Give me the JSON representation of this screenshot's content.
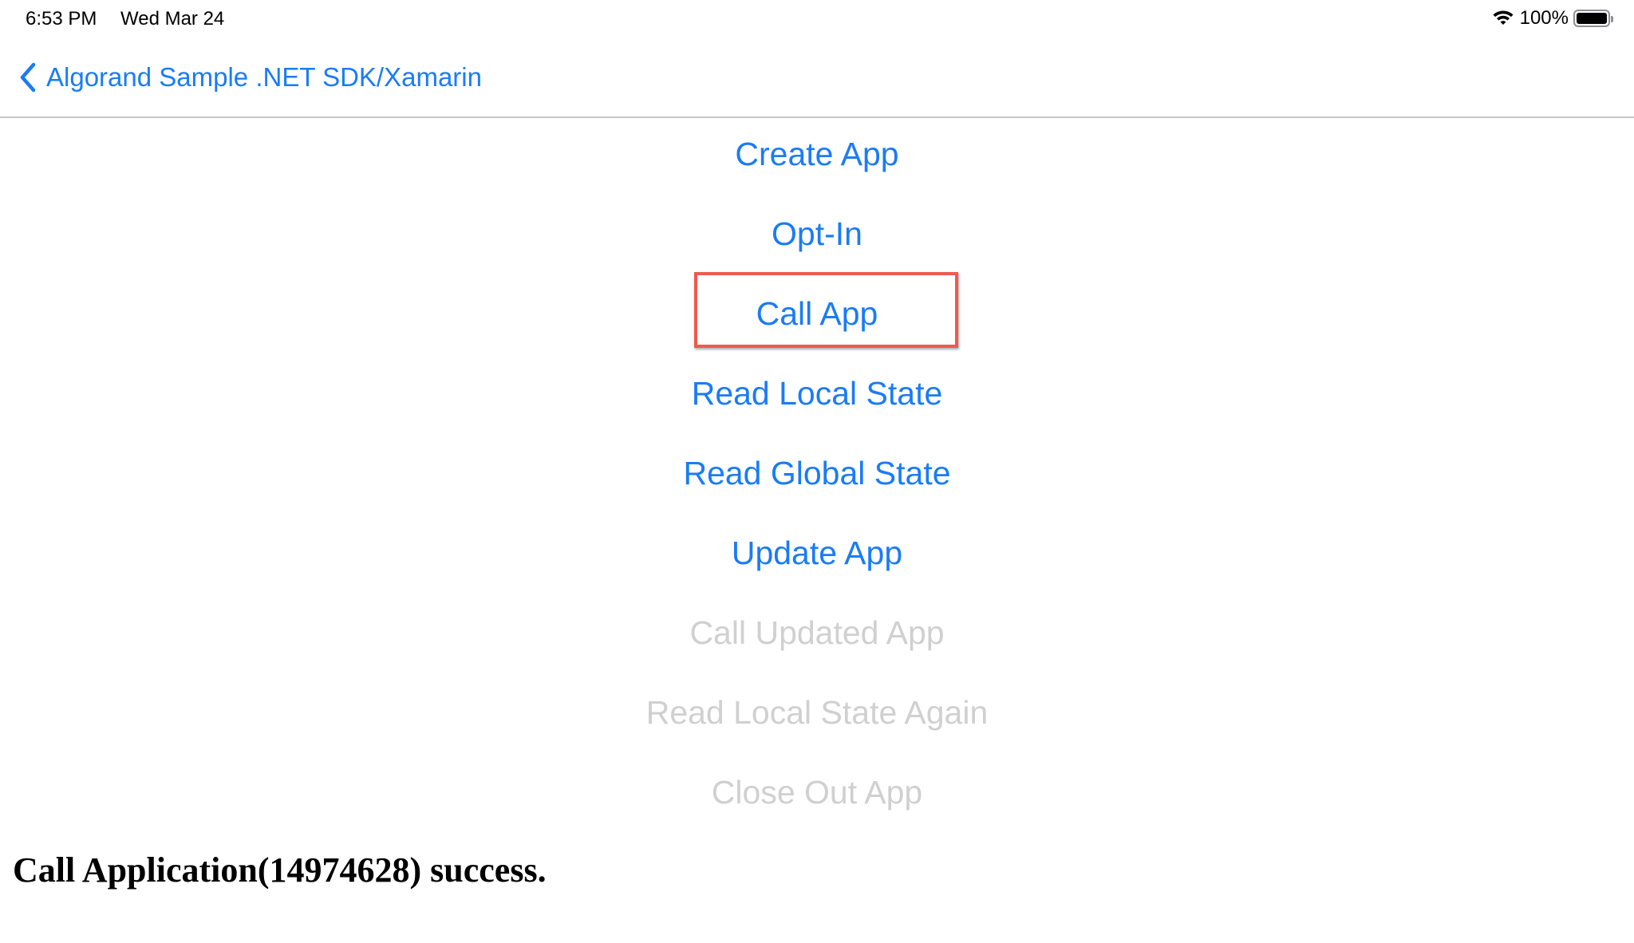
{
  "status_bar": {
    "time": "6:53 PM",
    "date": "Wed Mar 24",
    "battery_percent": "100%",
    "wifi_icon": "wifi-icon",
    "battery_icon": "battery-icon"
  },
  "nav": {
    "back_icon": "chevron-left-icon",
    "back_label": "Algorand Sample .NET SDK/Xamarin"
  },
  "menu": {
    "items": [
      {
        "label": "Create App",
        "enabled": true
      },
      {
        "label": "Opt-In",
        "enabled": true
      },
      {
        "label": "Call App",
        "enabled": true,
        "highlighted": true
      },
      {
        "label": "Read Local State",
        "enabled": true
      },
      {
        "label": "Read Global State",
        "enabled": true
      },
      {
        "label": "Update App",
        "enabled": true
      },
      {
        "label": "Call Updated App",
        "enabled": false
      },
      {
        "label": "Read Local State Again",
        "enabled": false
      },
      {
        "label": "Close Out App",
        "enabled": false
      }
    ]
  },
  "result": {
    "message": "Call Application(14974628) success."
  },
  "colors": {
    "accent": "#1a7cf5",
    "disabled": "#d0d0d0",
    "highlight_box": "#ef5a4f"
  }
}
